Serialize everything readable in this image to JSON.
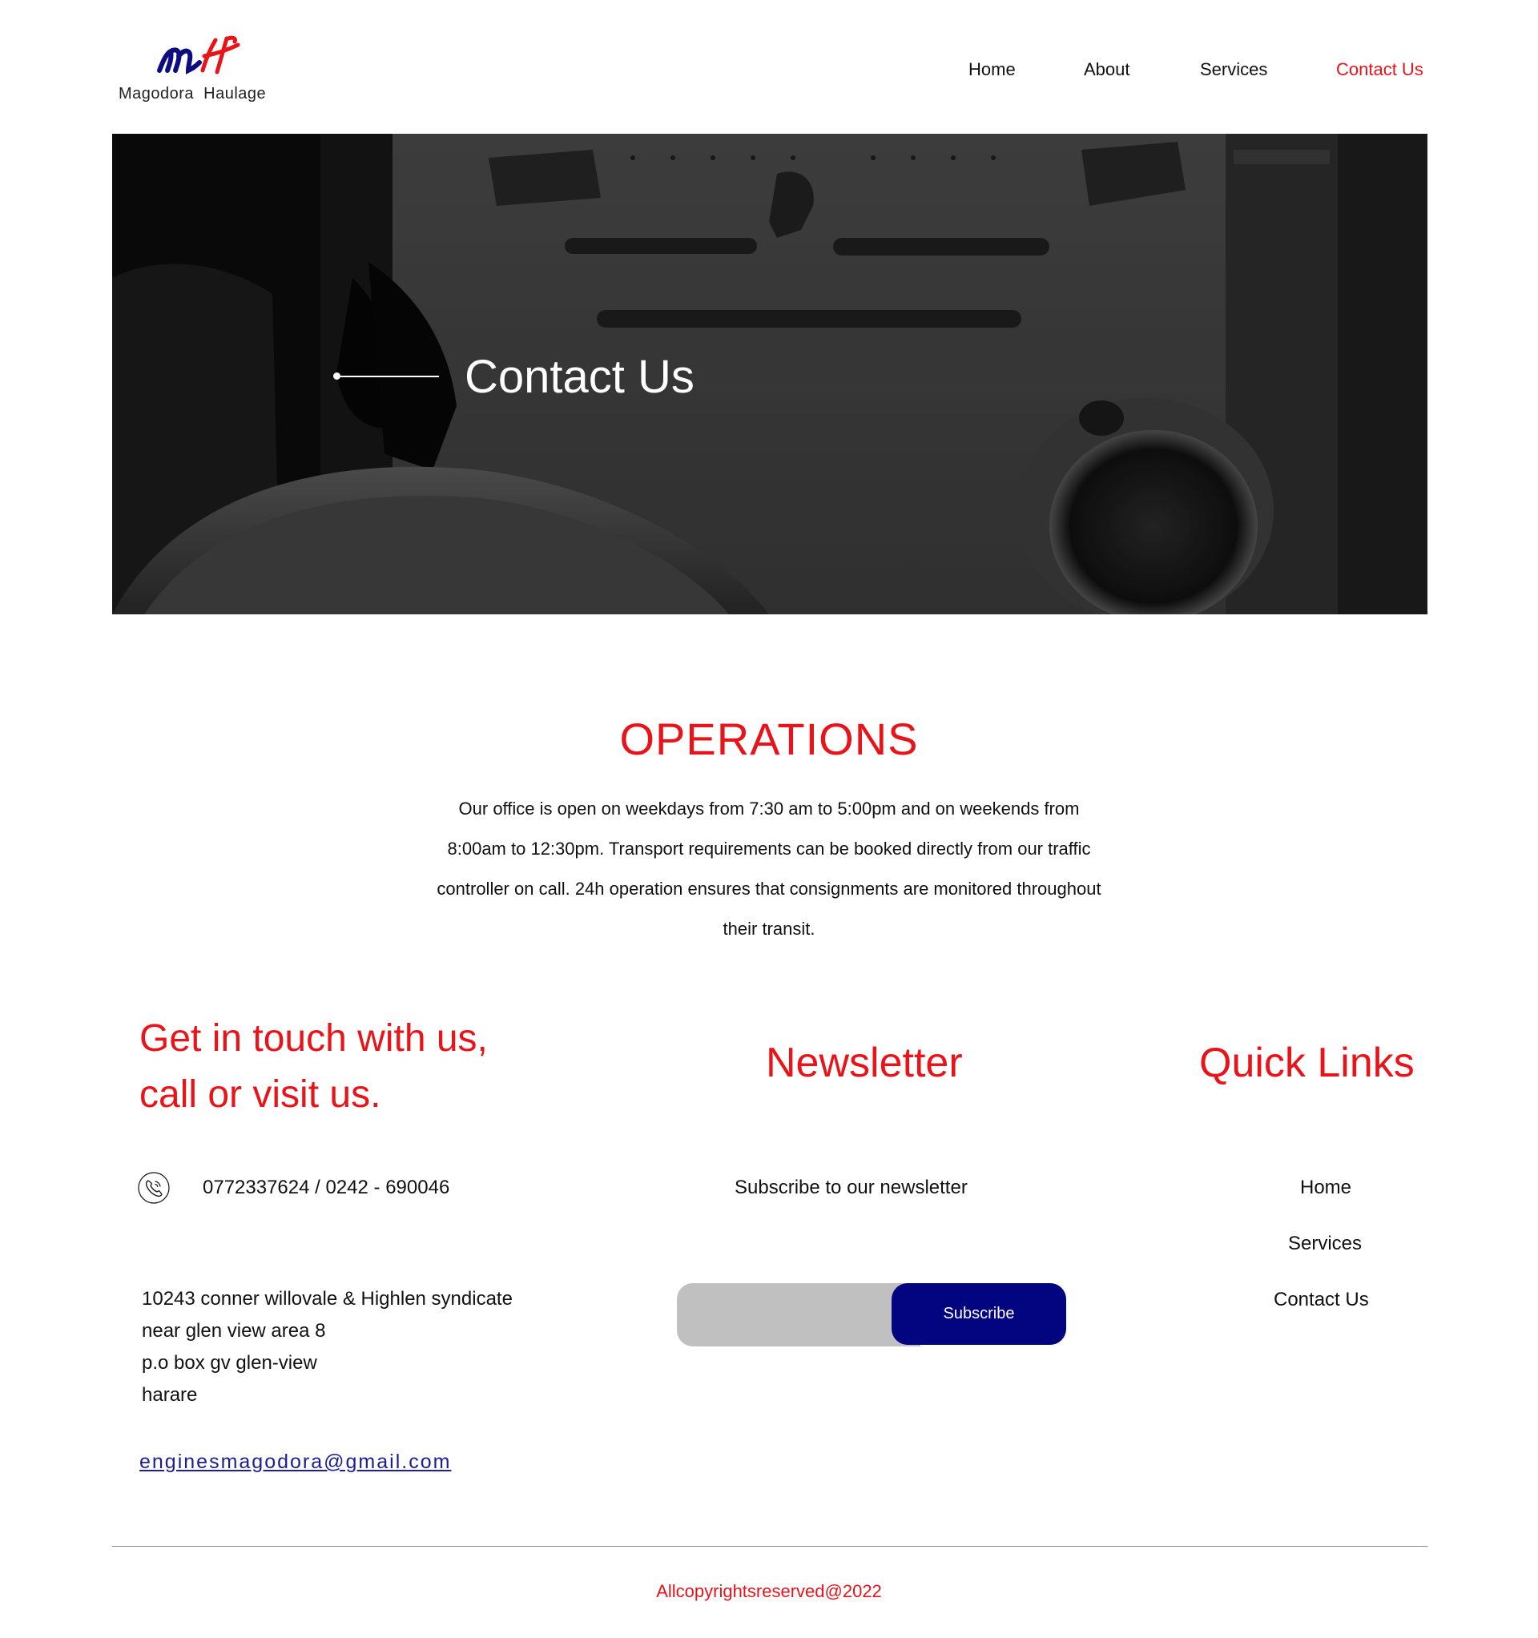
{
  "header": {
    "brand_name": "Magodora  Haulage",
    "logo_letters": "MH",
    "nav": [
      {
        "label": "Home"
      },
      {
        "label": "About"
      },
      {
        "label": "Services"
      },
      {
        "label": "Contact Us"
      }
    ],
    "active_nav": "Contact Us"
  },
  "hero": {
    "title": "Contact Us"
  },
  "operations": {
    "title": "OPERATIONS",
    "line1": "Our office is open on weekdays from 7:30 am to 5:00pm and on weekends from",
    "line2": "8:00am to 12:30pm. Transport requirements can be booked directly from our traffic",
    "line3": "controller on call. 24h operation ensures that consignments are monitored throughout",
    "line4": "their transit."
  },
  "contact": {
    "title_line1": "Get in touch with us,",
    "title_line2": "call or visit us.",
    "phone": "0772337624 / 0242 - 690046",
    "address": [
      "10243 conner willovale & Highlen syndicate",
      "near glen view area 8",
      "p.o box gv glen-view",
      "harare"
    ],
    "email": "enginesmagodora@gmail.com"
  },
  "newsletter": {
    "title": "Newsletter",
    "subtitle": "Subscribe to our newsletter",
    "input_value": "",
    "button_label": "Subscribe"
  },
  "quick_links": {
    "title": "Quick Links",
    "links": [
      {
        "label": "Home"
      },
      {
        "label": "Services"
      },
      {
        "label": "Contact Us"
      }
    ]
  },
  "footer": {
    "copyright": "Allcopyrightsreserved@2022"
  },
  "colors": {
    "accent_red": "#e8141a",
    "navy": "#02057f",
    "text": "#111111"
  }
}
